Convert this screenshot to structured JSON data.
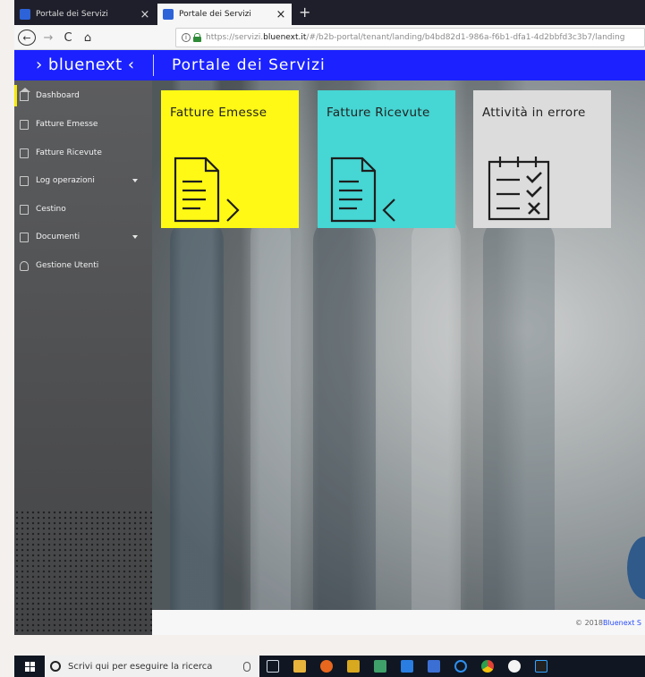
{
  "browser": {
    "tabs": [
      {
        "title": "Portale dei Servizi",
        "active": false
      },
      {
        "title": "Portale dei Servizi",
        "active": true
      }
    ],
    "new_tab": "+",
    "close": "×",
    "nav": {
      "back": "←",
      "forward": "→",
      "reload": "C",
      "home": "⌂"
    },
    "url": {
      "info": "i",
      "prefix": "https://servizi.",
      "host": "bluenext.it",
      "path": "/#/b2b-portal/tenant/landing/b4bd82d1-986a-f6b1-dfa1-4d2bbfd3c3b7/landing"
    }
  },
  "header": {
    "logo": "› bluenext ‹",
    "title": "Portale dei Servizi",
    "color": "#1b22ff"
  },
  "sidebar": {
    "items": [
      {
        "label": "Dashboard",
        "icon": "home-icon",
        "active": true
      },
      {
        "label": "Fatture Emesse",
        "icon": "invoice-out-icon"
      },
      {
        "label": "Fatture Ricevute",
        "icon": "invoice-in-icon"
      },
      {
        "label": "Log operazioni",
        "icon": "log-icon",
        "expandable": true
      },
      {
        "label": "Cestino",
        "icon": "trash-doc-icon"
      },
      {
        "label": "Documenti",
        "icon": "document-icon",
        "expandable": true
      },
      {
        "label": "Gestione Utenti",
        "icon": "user-icon"
      }
    ],
    "active_color": "#f5ea00"
  },
  "tiles": [
    {
      "label": "Fatture Emesse",
      "color": "#fff915",
      "icon": "document-arrow-right-icon"
    },
    {
      "label": "Fatture Ricevute",
      "color": "#46d6d3",
      "icon": "document-arrow-left-icon"
    },
    {
      "label": "Attività in errore",
      "color": "#dcdcdc",
      "icon": "checklist-error-icon"
    }
  ],
  "footer": {
    "copyright": "© 2018 ",
    "brand": "Bluenext S"
  },
  "taskbar": {
    "search_placeholder": "Scrivi qui per eseguire la ricerca"
  }
}
